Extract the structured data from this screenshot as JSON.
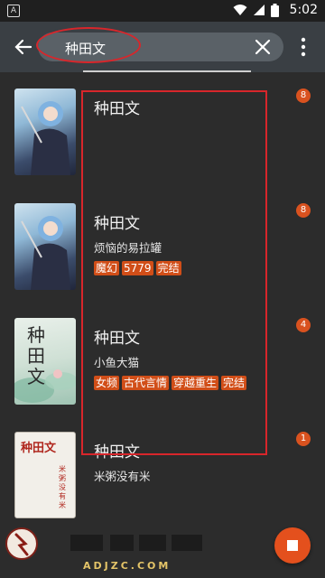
{
  "status_bar": {
    "app_badge": "A",
    "time": "5:02",
    "icons": [
      "wifi-icon",
      "signal-icon",
      "battery-icon"
    ]
  },
  "search": {
    "query": "种田文",
    "back_icon": "arrow-left-icon",
    "clear_icon": "close-icon",
    "menu_icon": "more-vert-icon"
  },
  "results": [
    {
      "title": "种田文",
      "author": "",
      "tags": [],
      "count": "8",
      "cover": "anime"
    },
    {
      "title": "种田文",
      "author": "烦恼的易拉罐",
      "tags": [
        "魔幻",
        "5779",
        "完结"
      ],
      "count": "8",
      "cover": "anime"
    },
    {
      "title": "种田文",
      "author": "小鱼大猫",
      "tags": [
        "女频",
        "古代言情",
        "穿越重生",
        "完结"
      ],
      "count": "4",
      "cover": "ink"
    },
    {
      "title": "种田文",
      "author": "米粥没有米",
      "tags": [],
      "count": "1",
      "cover": "paper"
    }
  ],
  "covers": {
    "ink_title": "种田文",
    "paper_title": "种田文",
    "paper_subtitle": "米粥没有米"
  },
  "watermark": {
    "text": "ADJZC.COM"
  },
  "colors": {
    "accent": "#e4501d",
    "tag": "#d14e18",
    "annotation": "#d8262b",
    "header": "#3a3f44",
    "background": "#2c2c2c"
  }
}
